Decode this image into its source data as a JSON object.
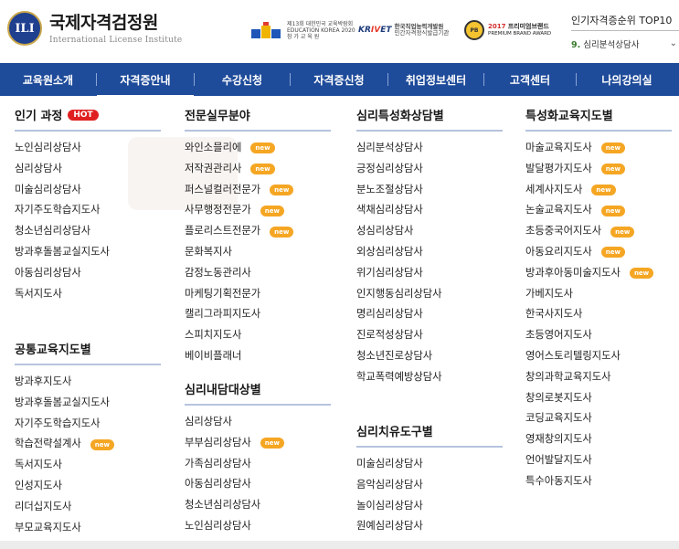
{
  "logo": {
    "mark": "ILI",
    "name_ko": "국제자격검정원",
    "name_en": "International License Institute"
  },
  "awards": {
    "award1_text": [
      "제13회 대한민국 교육박람회",
      "EDUCATION KOREA 2020",
      "참 가 교 육 원"
    ],
    "krivet_prefix": "KR",
    "krivet_mid": "IV",
    "krivet_suffix": "ET",
    "krivet_text": [
      "한국직업능력개발원",
      "민간자격정식발급기관"
    ],
    "premium_mark": "PB",
    "premium_year": "2017",
    "premium_title": "프리미엄브랜드",
    "premium_sub": "PREMIUM BRAND AWARD"
  },
  "ranking": {
    "title": "인기자격증순위 TOP10",
    "current_number": "9.",
    "current_label": "심리분석상담사"
  },
  "nav": {
    "items": [
      "교육원소개",
      "자격증안내",
      "수강신청",
      "자격증신청",
      "취업정보센터",
      "고객센터",
      "나의강의실"
    ]
  },
  "menu": {
    "popular": {
      "title": "인기 과정",
      "hot": "HOT",
      "items": [
        "노인심리상담사",
        "심리상담사",
        "미술심리상담사",
        "자기주도학습지도사",
        "청소년심리상담사",
        "방과후돌봄교실지도사",
        "아동심리상담사",
        "독서지도사"
      ]
    },
    "common": {
      "title": "공통교육지도별",
      "items": [
        "방과후지도사",
        "방과후돌봄교실지도사",
        "자기주도학습지도사",
        "학습전략설계사",
        "독서지도사",
        "인성지도사",
        "리더십지도사",
        "부모교육지도사"
      ]
    },
    "professional": {
      "title": "전문실무분야",
      "items": [
        "와인소믈리에",
        "저작권관리사",
        "퍼스널컬러전문가",
        "사무행정전문가",
        "플로리스트전문가",
        "문화복지사",
        "감정노동관리사",
        "마케팅기획전문가",
        "캘리그라피지도사",
        "스피치지도사",
        "베이비플래너"
      ]
    },
    "counsel_target": {
      "title": "심리내담대상별",
      "items": [
        "심리상담사",
        "부부심리상담사",
        "가족심리상담사",
        "아동심리상담사",
        "청소년심리상담사",
        "노인심리상담사"
      ]
    },
    "specialized_counsel": {
      "title": "심리특성화상담별",
      "items": [
        "심리분석상담사",
        "긍정심리상담사",
        "분노조절상담사",
        "색채심리상담사",
        "성심리상담사",
        "외상심리상담사",
        "위기심리상담사",
        "인지행동심리상담사",
        "명리심리상담사",
        "진로적성상담사",
        "청소년진로상담사",
        "학교폭력예방상담사"
      ]
    },
    "therapy_tool": {
      "title": "심리치유도구별",
      "items": [
        "미술심리상담사",
        "음악심리상담사",
        "놀이심리상담사",
        "원예심리상담사"
      ]
    },
    "specialized_edu": {
      "title": "특성화교육지도별",
      "items": [
        "마술교육지도사",
        "발달평가지도사",
        "세계사지도사",
        "논술교육지도사",
        "초등중국어지도사",
        "아동요리지도사",
        "방과후아동미술지도사",
        "가베지도사",
        "한국사지도사",
        "초등영어지도사",
        "영어스토리텔링지도사",
        "창의과학교육지도사",
        "창의로봇지도사",
        "코딩교육지도사",
        "영재창의지도사",
        "언어발달지도사",
        "특수아동지도사"
      ]
    },
    "new_badge": "new"
  },
  "colors": {
    "nav_bg": "#1e4b9a",
    "hot_badge": "#e02020",
    "new_badge": "#f5a623",
    "underline": "#b6c3de"
  }
}
